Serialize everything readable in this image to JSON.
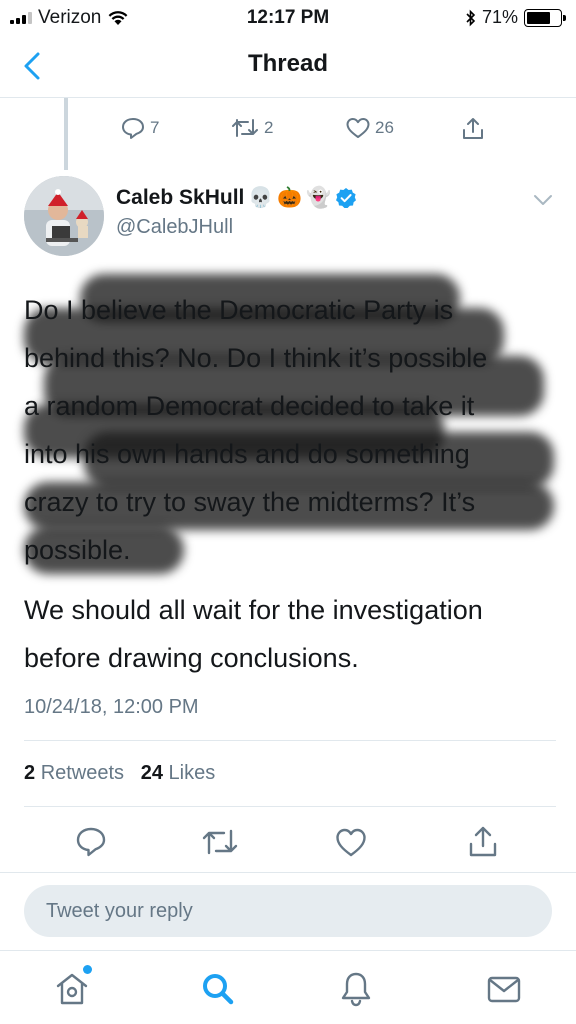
{
  "status_bar": {
    "carrier": "Verizon",
    "time": "12:17 PM",
    "battery": "71%",
    "battery_level": 0.71
  },
  "nav": {
    "title": "Thread"
  },
  "previous_tweet": {
    "reply_count": "7",
    "retweet_count": "2",
    "like_count": "26"
  },
  "tweet": {
    "author_name": "Caleb SkHull",
    "author_emojis": [
      "💀",
      "🎃",
      "👻"
    ],
    "handle": "@CalebJHull",
    "paragraphs": [
      [
        "Do I believe the Democratic Party is",
        "behind this? No. Do I think it’s possible",
        "a random Democrat decided to take it",
        "into his own hands and do something",
        "crazy to try to sway the midterms? It’s",
        "possible."
      ],
      [
        "We should all wait for the investigation",
        "before drawing conclusions."
      ]
    ],
    "timestamp": "10/24/18, 12:00 PM",
    "retweets_count": "2",
    "retweets_label": "Retweets",
    "likes_count": "24",
    "likes_label": "Likes"
  },
  "reply": {
    "placeholder": "Tweet your reply"
  },
  "colors": {
    "accent": "#1da1f2",
    "muted": "#657786",
    "divider": "#e1e8ed",
    "reply_bg": "#e6ecf0"
  }
}
